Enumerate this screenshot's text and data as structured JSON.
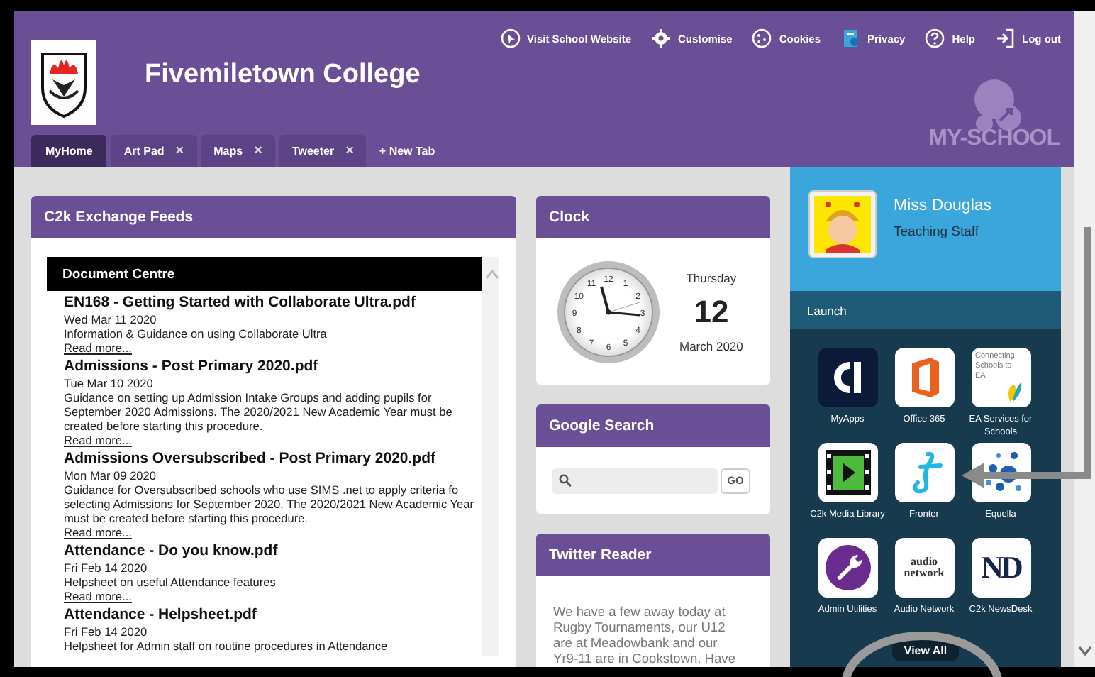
{
  "header": {
    "school_name": "Fivemiletown College",
    "logo_text": "MY-SCHOOL",
    "top_links": [
      {
        "kind": "cursor",
        "label": "Visit School Website"
      },
      {
        "kind": "gear",
        "label": "Customise"
      },
      {
        "kind": "cookie",
        "label": "Cookies"
      },
      {
        "kind": "privacy",
        "label": "Privacy"
      },
      {
        "kind": "help",
        "label": "Help"
      },
      {
        "kind": "logout",
        "label": "Log out"
      }
    ]
  },
  "tabs": [
    {
      "label": "MyHome",
      "selected": true
    },
    {
      "label": "Art Pad",
      "selected": false,
      "close": "×"
    },
    {
      "label": "Maps",
      "selected": false,
      "close": "×"
    },
    {
      "label": "Tweeter",
      "selected": false,
      "close": "×"
    }
  ],
  "new_tab": "+ New Tab",
  "feeds": {
    "title": "C2k Exchange Feeds",
    "section": "Document Centre",
    "items": [
      {
        "title": "EN168 - Getting Started with Collaborate Ultra.pdf",
        "date": "Wed Mar 11 2020",
        "description": "Information & Guidance on using Collaborate Ultra",
        "link": "Read more..."
      },
      {
        "title": "Admissions - Post Primary 2020.pdf",
        "date": "Tue Mar 10 2020",
        "description": "Guidance on setting up Admission Intake Groups and adding pupils for September 2020 Admissions. The 2020/2021 New Academic Year must be created before starting this procedure.",
        "link": "Read more..."
      },
      {
        "title": "Admissions Oversubscribed - Post Primary 2020.pdf",
        "date": "Mon Mar 09 2020",
        "description": "Guidance for Oversubscribed schools who use SIMS .net to apply criteria fo selecting Admissions for September 2020. The 2020/2021 New Academic Year must be created before starting this procedure.",
        "link": "Read more..."
      },
      {
        "title": "Attendance - Do you know.pdf",
        "date": "Fri Feb 14 2020",
        "description": "Helpsheet on useful Attendance features",
        "link": "Read more..."
      },
      {
        "title": "Attendance - Helpsheet.pdf",
        "date": "Fri Feb 14 2020",
        "description": "Helpsheet for Admin staff on routine procedures in Attendance"
      }
    ]
  },
  "clock": {
    "title": "Clock",
    "dial_numbers": [
      "12",
      "1",
      "2",
      "3",
      "4",
      "5",
      "6",
      "7",
      "8",
      "9",
      "10",
      "11"
    ],
    "weekday": "Thursday",
    "day": "12",
    "month_year": "March 2020"
  },
  "google_search": {
    "title": "Google Search",
    "button": "GO"
  },
  "twitter": {
    "title": "Twitter Reader",
    "text": "We have a few away today at Rugby Tournaments, our U12 are at Meadowbank and our Yr9-11 are in Cookstown. Have"
  },
  "profile": {
    "name": "Miss Douglas",
    "role": "Teaching Staff"
  },
  "launch": {
    "title": "Launch",
    "apps": [
      {
        "kind": "myapps",
        "label": "MyApps"
      },
      {
        "kind": "office",
        "label": "Office 365"
      },
      {
        "kind": "ea",
        "label": "EA Services for Schools",
        "icon_text": "Connecting Schools to EA"
      },
      {
        "kind": "media",
        "label": "C2k Media Library"
      },
      {
        "kind": "fronter",
        "label": "Fronter"
      },
      {
        "kind": "equella",
        "label": "Equella"
      },
      {
        "kind": "admin",
        "label": "Admin Utilities"
      },
      {
        "kind": "audio",
        "label": "Audio Network",
        "icon_text": "audio network"
      },
      {
        "kind": "newsdesk",
        "label": "C2k NewsDesk",
        "icon_text": "ND"
      }
    ],
    "view_all": "View All"
  }
}
